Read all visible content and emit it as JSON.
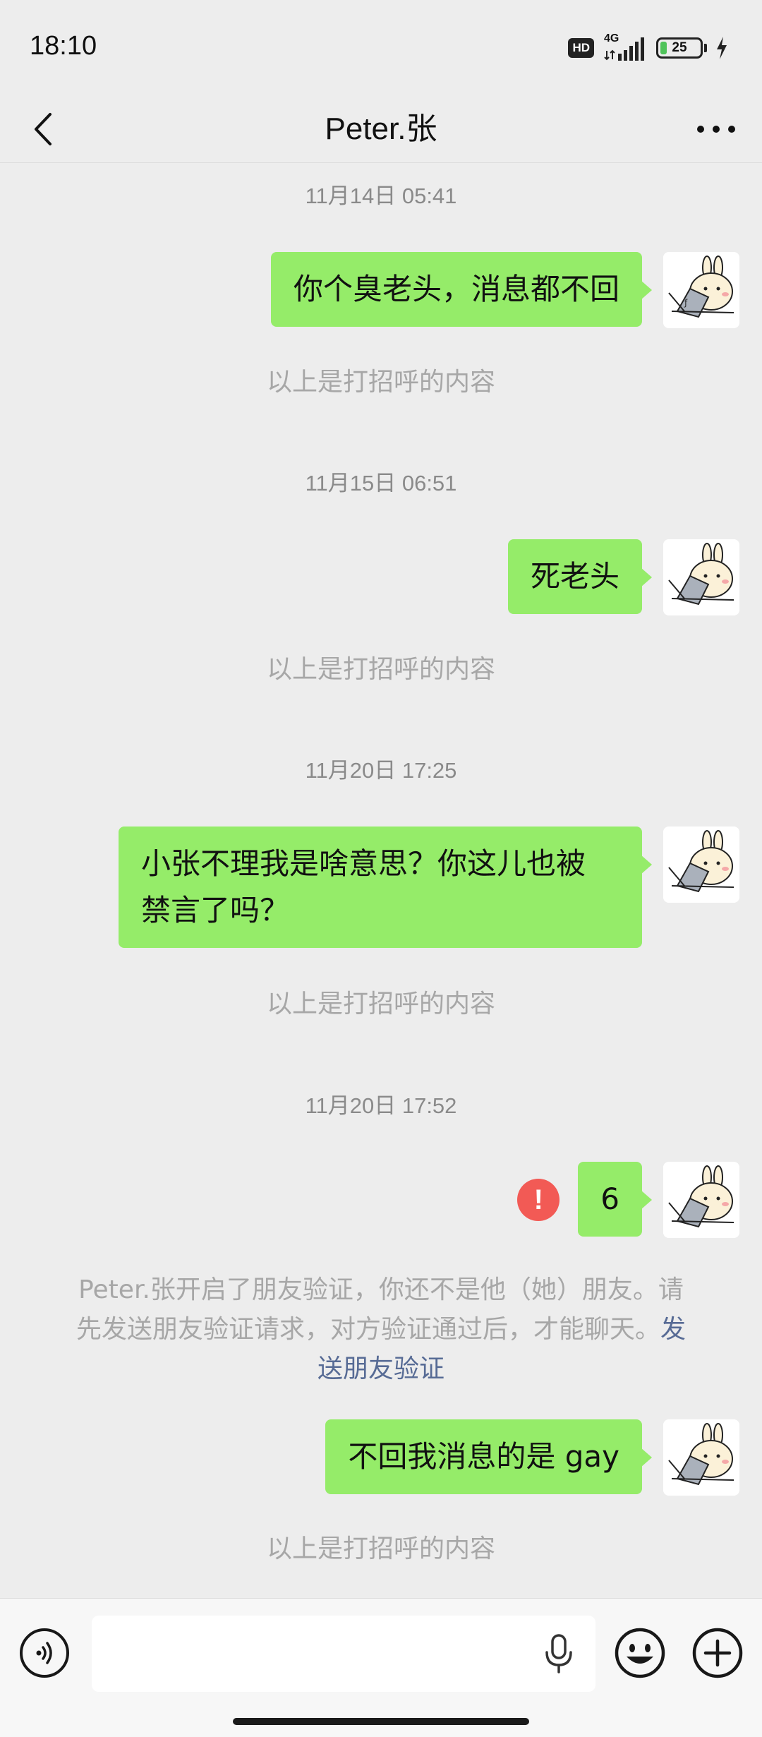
{
  "status_bar": {
    "time": "18:10",
    "hd": "HD",
    "network": "4G",
    "battery_level": "25",
    "battery_fraction": 0.25
  },
  "header": {
    "title": "Peter.张",
    "back_icon": "chevron-left-icon",
    "more_icon": "more-dots-icon"
  },
  "messages": [
    {
      "timestamp": "11月14日 05:41",
      "text": "你个臭老头，消息都不回",
      "note": "以上是打招呼的内容"
    },
    {
      "timestamp": "11月15日 06:51",
      "text": "死老头",
      "note": "以上是打招呼的内容"
    },
    {
      "timestamp": "11月20日 17:25",
      "text_line1": "小张不理我是啥意思？你这儿也被",
      "text_line2": "禁言了吗？",
      "note": "以上是打招呼的内容"
    },
    {
      "timestamp": "11月20日 17:52",
      "text": "6",
      "error": "!"
    },
    {
      "text": "不回我消息的是 gay",
      "note": "以上是打招呼的内容"
    }
  ],
  "verify_notice": {
    "line1": "Peter.张开启了朋友验证，你还不是他（她）朋友。请",
    "line2": "先发送朋友验证请求，对方验证通过后，才能聊天。",
    "link_part1": "发",
    "link_part2": "送朋友验证"
  },
  "input_bar": {
    "message_value": "",
    "icons": [
      "voice-icon",
      "mic-icon",
      "emoji-icon",
      "plus-icon"
    ]
  },
  "colors": {
    "bubble": "#95ec69",
    "background": "#ededed",
    "link": "#576b95",
    "error": "#f25a55"
  }
}
